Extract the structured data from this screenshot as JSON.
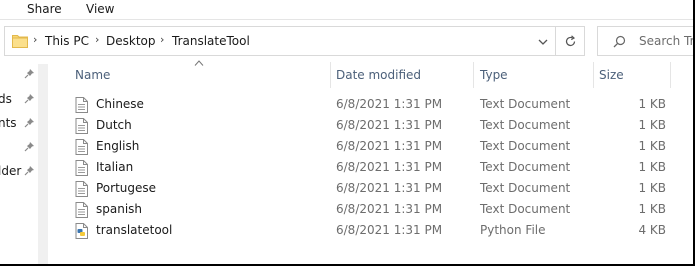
{
  "ribbon": {
    "tabs": [
      "Share",
      "View"
    ]
  },
  "address": {
    "crumbs": [
      "This PC",
      "Desktop",
      "TranslateTool"
    ],
    "search_placeholder": "Search Tra"
  },
  "nav": {
    "labels": [
      "ds",
      "nts",
      "lder"
    ]
  },
  "columns": {
    "name": "Name",
    "date": "Date modified",
    "type": "Type",
    "size": "Size"
  },
  "files": [
    {
      "name": "Chinese",
      "date": "6/8/2021 1:31 PM",
      "type": "Text Document",
      "size": "1 KB",
      "icon": "text-file-icon"
    },
    {
      "name": "Dutch",
      "date": "6/8/2021 1:31 PM",
      "type": "Text Document",
      "size": "1 KB",
      "icon": "text-file-icon"
    },
    {
      "name": "English",
      "date": "6/8/2021 1:31 PM",
      "type": "Text Document",
      "size": "1 KB",
      "icon": "text-file-icon"
    },
    {
      "name": "Italian",
      "date": "6/8/2021 1:31 PM",
      "type": "Text Document",
      "size": "1 KB",
      "icon": "text-file-icon"
    },
    {
      "name": "Portugese",
      "date": "6/8/2021 1:31 PM",
      "type": "Text Document",
      "size": "1 KB",
      "icon": "text-file-icon"
    },
    {
      "name": "spanish",
      "date": "6/8/2021 1:31 PM",
      "type": "Text Document",
      "size": "1 KB",
      "icon": "text-file-icon"
    },
    {
      "name": "translatetool",
      "date": "6/8/2021 1:31 PM",
      "type": "Python File",
      "size": "4 KB",
      "icon": "python-file-icon"
    }
  ],
  "colors": {
    "header_text": "#4c607a",
    "muted_text": "#6d6d6d",
    "border": "#d9d9d9",
    "window_frame": "#000000"
  }
}
